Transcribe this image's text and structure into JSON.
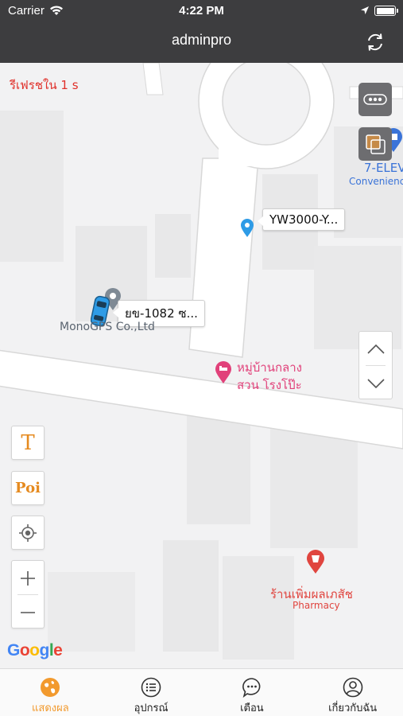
{
  "status_bar": {
    "carrier": "Carrier",
    "time": "4:22 PM"
  },
  "nav": {
    "title": "adminpro",
    "refresh_icon": "refresh-icon"
  },
  "map": {
    "refresh_notice": "รีเฟรชใน 1 s",
    "vehicles": [
      {
        "label": "YW3000-Y...",
        "marker": "location-pin-icon",
        "color": "#2e9be6"
      },
      {
        "label": "ยข-1082 ซ...",
        "marker": "car-icon",
        "color": "#2e9be6"
      }
    ],
    "places": [
      {
        "name": "MonoGPS Co.,Ltd",
        "icon": "place-pin-icon"
      },
      {
        "name_line1": "หมู่บ้านกลาง",
        "name_line2": "สวน โรงโป๊ะ",
        "icon": "lodging-pin-icon",
        "color": "#e1417a"
      },
      {
        "name": "ร้านเพิ่มผลเภสัช",
        "category": "Pharmacy",
        "icon": "pharmacy-pin-icon",
        "color": "#e0453f"
      },
      {
        "name": "7-ELEV",
        "category": "Convenienc",
        "icon": "store-pin-icon",
        "color": "#3a73d8"
      }
    ],
    "tools": {
      "text_tool": "T",
      "poi_tool": "Poi"
    },
    "attribution": "Google"
  },
  "tabs": [
    {
      "label": "แสดงผล",
      "icon": "map-globe-icon",
      "active": true
    },
    {
      "label": "อุปกรณ์",
      "icon": "list-icon",
      "active": false
    },
    {
      "label": "เตือน",
      "icon": "chat-bubble-icon",
      "active": false
    },
    {
      "label": "เกี่ยวกับฉัน",
      "icon": "user-icon",
      "active": false
    }
  ],
  "colors": {
    "accent": "#f29a2e",
    "bar": "#3d3d3f",
    "notice": "#e0302a"
  }
}
